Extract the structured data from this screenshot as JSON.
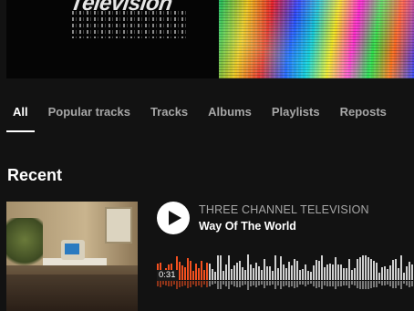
{
  "banner": {
    "logo_text": "Television"
  },
  "tabs": [
    {
      "label": "All",
      "active": true
    },
    {
      "label": "Popular tracks",
      "active": false
    },
    {
      "label": "Tracks",
      "active": false
    },
    {
      "label": "Albums",
      "active": false
    },
    {
      "label": "Playlists",
      "active": false
    },
    {
      "label": "Reposts",
      "active": false
    }
  ],
  "recent": {
    "title": "Recent",
    "track": {
      "artist": "THREE CHANNEL TELEVISION",
      "title": "Way Of The World",
      "elapsed": "0:31",
      "progress": 0.2,
      "colors": {
        "played": "#f4501f",
        "unplayed": "#cfcfcf"
      }
    }
  }
}
